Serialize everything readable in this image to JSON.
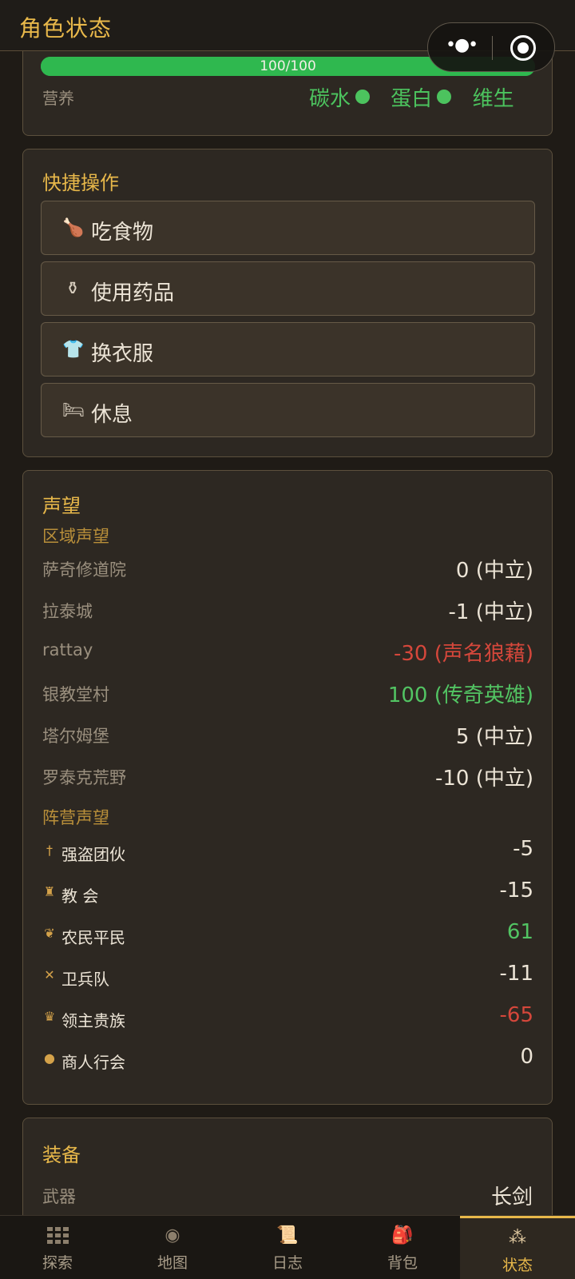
{
  "header": {
    "title": "角色状态"
  },
  "nutrition": {
    "progress_text": "100/100",
    "progress_fraction": 1.0,
    "label": "营养",
    "macros": [
      {
        "label": "碳水"
      },
      {
        "label": "蛋白"
      },
      {
        "label": "维生"
      }
    ],
    "accent_color": "#4cc35e"
  },
  "capsule": {
    "more_icon": "more-dots-icon",
    "close_icon": "target-close-icon"
  },
  "quick_actions": {
    "title": "快捷操作",
    "buttons": [
      {
        "label": "吃食物",
        "icon": "drumstick-icon",
        "glyph": "🍗"
      },
      {
        "label": "使用药品",
        "icon": "potion-icon",
        "glyph": "⚱"
      },
      {
        "label": "换衣服",
        "icon": "shirt-icon",
        "glyph": "👕"
      },
      {
        "label": "休息",
        "icon": "bed-icon",
        "glyph": "🛏"
      }
    ]
  },
  "reputation": {
    "title": "声望",
    "region_title": "区域声望",
    "regions": [
      {
        "name": "萨奇修道院",
        "value": "0 (中立)",
        "tone": "neutral"
      },
      {
        "name": "拉泰城",
        "value": "-1 (中立)",
        "tone": "neutral"
      },
      {
        "name": "rattay",
        "value": "-30 (声名狼藉)",
        "tone": "neg"
      },
      {
        "name": "银教堂村",
        "value": "100 (传奇英雄)",
        "tone": "pos"
      },
      {
        "name": "塔尔姆堡",
        "value": "5 (中立)",
        "tone": "neutral"
      },
      {
        "name": "罗泰克荒野",
        "value": "-10 (中立)",
        "tone": "neutral"
      }
    ],
    "faction_title": "阵营声望",
    "factions": [
      {
        "name": "强盗团伙",
        "value": "-5",
        "tone": "neutral",
        "icon": "dagger-icon",
        "glyph": "†"
      },
      {
        "name": "教 会",
        "value": "-15",
        "tone": "neutral",
        "icon": "church-icon",
        "glyph": "♜"
      },
      {
        "name": "农民平民",
        "value": "61",
        "tone": "pos",
        "icon": "wheat-icon",
        "glyph": "❦"
      },
      {
        "name": "卫兵队",
        "value": "-11",
        "tone": "neutral",
        "icon": "crossed-swords-icon",
        "glyph": "✕"
      },
      {
        "name": "领主贵族",
        "value": "-65",
        "tone": "neg",
        "icon": "crown-icon",
        "glyph": "♛"
      },
      {
        "name": "商人行会",
        "value": "0",
        "tone": "neutral",
        "icon": "coin-bag-icon",
        "glyph": "●"
      }
    ]
  },
  "equipment": {
    "title": "装备",
    "weapon_label": "武器",
    "weapon_value": "长剑"
  },
  "tabs": [
    {
      "label": "探索",
      "icon": "explore-grid-icon"
    },
    {
      "label": "地图",
      "icon": "map-compass-icon"
    },
    {
      "label": "日志",
      "icon": "scroll-icon"
    },
    {
      "label": "背包",
      "icon": "backpack-icon"
    },
    {
      "label": "状态",
      "icon": "status-grid-icon",
      "active": true
    }
  ]
}
